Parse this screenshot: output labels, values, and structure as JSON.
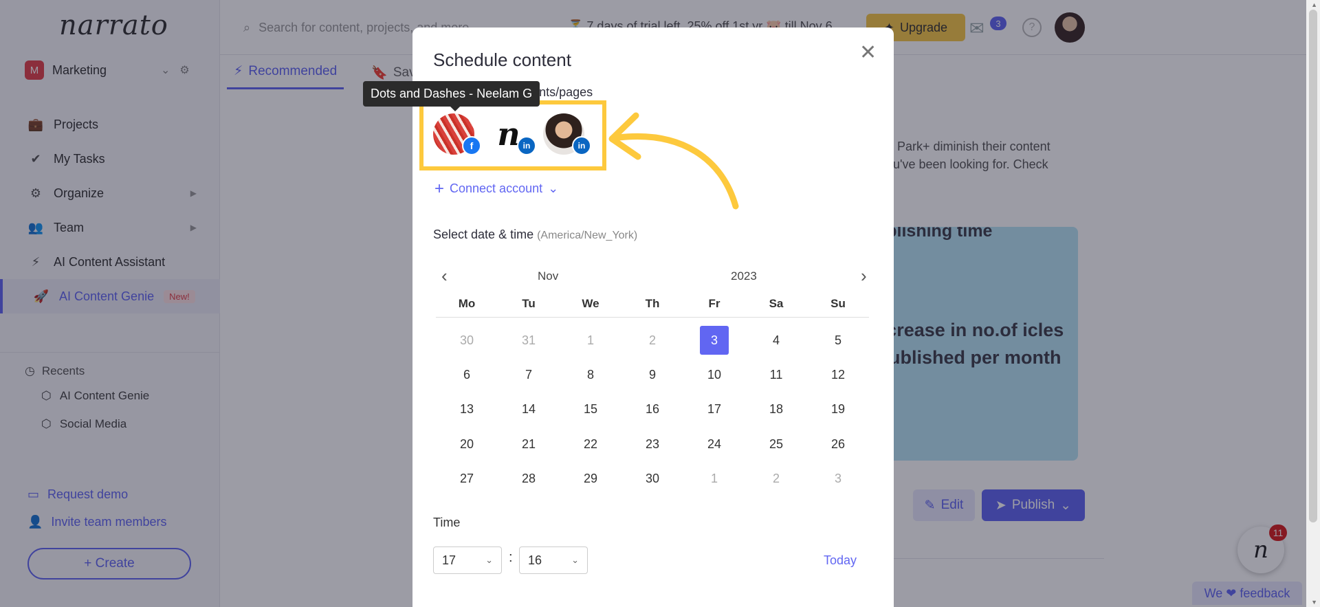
{
  "app": {
    "logo": "narrato",
    "workspace": {
      "badge": "M",
      "name": "Marketing"
    },
    "nav": [
      {
        "label": "Projects",
        "icon": "briefcase-icon",
        "glyph": "💼"
      },
      {
        "label": "My Tasks",
        "icon": "checkmark-icon",
        "glyph": "✔"
      },
      {
        "label": "Organize",
        "icon": "gears-icon",
        "glyph": "⚙",
        "arrow": "▶"
      },
      {
        "label": "Team",
        "icon": "team-icon",
        "glyph": "👥",
        "arrow": "▶"
      },
      {
        "label": "AI Content Assistant",
        "icon": "lightning-icon",
        "glyph": "⚡"
      },
      {
        "label": "AI Content Genie",
        "icon": "rocket-icon",
        "glyph": "🚀",
        "badge": "New!"
      }
    ],
    "recents": {
      "title": "Recents",
      "items": [
        "AI Content Genie",
        "Social Media"
      ]
    },
    "request_demo": "Request demo",
    "invite": "Invite team members",
    "create": "+ Create",
    "search_placeholder": "Search for content, projects, and more",
    "trial_text": "7 days of trial left. 25% off 1st yr 🐷 till Nov 6.",
    "upgrade": "Upgrade",
    "mail_count": "3",
    "tabs": [
      {
        "label": "Recommended",
        "glyph": "⚡"
      },
      {
        "label": "Saved",
        "glyph": "🔖"
      }
    ],
    "card_text": "ed Park+ diminish their content you've been looking for. Check",
    "promo_title": "ublishing time",
    "promo_main": "ncrease in no.of icles published per month",
    "edit": "Edit",
    "more": "r",
    "publish": "Publish",
    "chat_count": "11",
    "feedback": "We ❤ feedback"
  },
  "modal": {
    "title": "Schedule content",
    "close": "✕",
    "accounts_label": "Select social accounts/pages",
    "tooltip": "Dots and Dashes - Neelam G",
    "accounts": [
      {
        "name": "Dots and Dashes",
        "network": "facebook"
      },
      {
        "name": "Narrato",
        "network": "linkedin"
      },
      {
        "name": "Neelam G",
        "network": "linkedin"
      }
    ],
    "connect_account": "Connect account",
    "date_label": "Select date & time",
    "timezone": "(America/New_York)",
    "calendar": {
      "month": "Nov",
      "year": "2023",
      "weekdays": [
        "Mo",
        "Tu",
        "We",
        "Th",
        "Fr",
        "Sa",
        "Su"
      ],
      "selected": "3",
      "days": [
        [
          "30",
          "31",
          "1",
          "2",
          "3",
          "4",
          "5"
        ],
        [
          "6",
          "7",
          "8",
          "9",
          "10",
          "11",
          "12"
        ],
        [
          "13",
          "14",
          "15",
          "16",
          "17",
          "18",
          "19"
        ],
        [
          "20",
          "21",
          "22",
          "23",
          "24",
          "25",
          "26"
        ],
        [
          "27",
          "28",
          "29",
          "30",
          "1",
          "2",
          "3"
        ]
      ],
      "muted": [
        [
          0,
          0
        ],
        [
          0,
          1
        ],
        [
          0,
          2
        ],
        [
          0,
          3
        ],
        [
          4,
          4
        ],
        [
          4,
          5
        ],
        [
          4,
          6
        ]
      ]
    },
    "time_label": "Time",
    "hour": "17",
    "minute": "16",
    "separator": ":",
    "today": "Today"
  }
}
